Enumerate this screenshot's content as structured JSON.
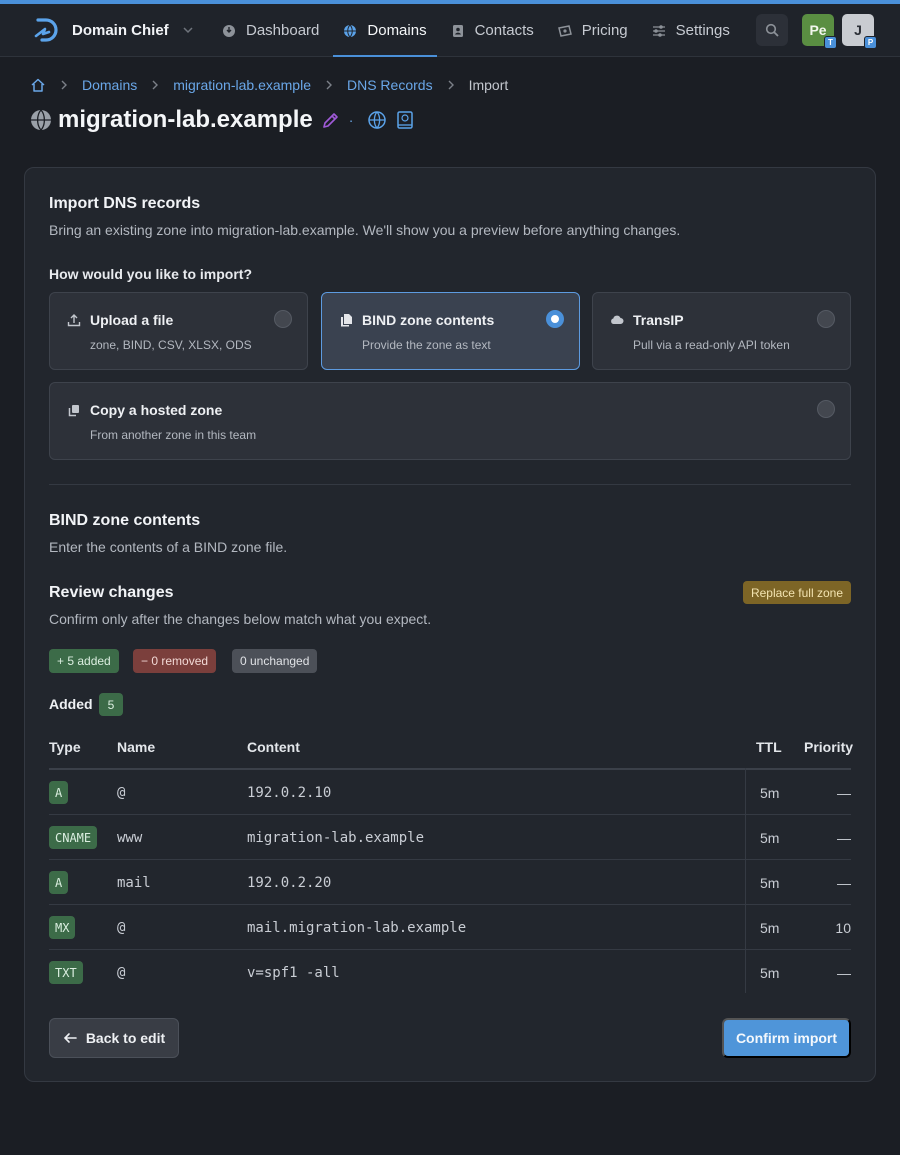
{
  "app": {
    "name": "Domain Chief"
  },
  "nav": {
    "items": [
      {
        "label": "Dashboard",
        "icon": "dashboard-icon",
        "active": false
      },
      {
        "label": "Domains",
        "icon": "globe-icon",
        "active": true
      },
      {
        "label": "Contacts",
        "icon": "contact-card-icon",
        "active": false
      },
      {
        "label": "Pricing",
        "icon": "money-icon",
        "active": false
      },
      {
        "label": "Settings",
        "icon": "sliders-icon",
        "active": false
      }
    ],
    "avatars": [
      {
        "initials": "Pe",
        "badge": "T"
      },
      {
        "initials": "J",
        "badge": "P"
      }
    ]
  },
  "breadcrumb": {
    "items": [
      "Domains",
      "migration-lab.example",
      "DNS Records"
    ],
    "current": "Import"
  },
  "page": {
    "title": "migration-lab.example"
  },
  "import": {
    "heading": "Import DNS records",
    "description": "Bring an existing zone into migration-lab.example. We'll show you a preview before anything changes.",
    "question": "How would you like to import?",
    "options": [
      {
        "title": "Upload a file",
        "desc": "zone, BIND, CSV, XLSX, ODS",
        "icon": "upload-icon",
        "selected": false
      },
      {
        "title": "BIND zone contents",
        "desc": "Provide the zone as text",
        "icon": "documents-icon",
        "selected": true
      },
      {
        "title": "TransIP",
        "desc": "Pull via a read-only API token",
        "icon": "cloud-icon",
        "selected": false
      },
      {
        "title": "Copy a hosted zone",
        "desc": "From another zone in this team",
        "icon": "copy-icon",
        "selected": false
      }
    ]
  },
  "bind": {
    "heading": "BIND zone contents",
    "description": "Enter the contents of a BIND zone file."
  },
  "review": {
    "heading": "Review changes",
    "description": "Confirm only after the changes below match what you expect.",
    "mode_badge": "Replace full zone",
    "pills": {
      "added": "+ 5 added",
      "removed": "− 0 removed",
      "unchanged": "0 unchanged"
    },
    "added_label": "Added",
    "added_count": "5",
    "columns": {
      "type": "Type",
      "name": "Name",
      "content": "Content",
      "ttl": "TTL",
      "priority": "Priority"
    },
    "rows": [
      {
        "type": "A",
        "name": "@",
        "content": "192.0.2.10",
        "ttl": "5m",
        "priority": "—"
      },
      {
        "type": "CNAME",
        "name": "www",
        "content": "migration-lab.example",
        "ttl": "5m",
        "priority": "—"
      },
      {
        "type": "A",
        "name": "mail",
        "content": "192.0.2.20",
        "ttl": "5m",
        "priority": "—"
      },
      {
        "type": "MX",
        "name": "@",
        "content": "mail.migration-lab.example",
        "ttl": "5m",
        "priority": "10"
      },
      {
        "type": "TXT",
        "name": "@",
        "content": "v=spf1 -all",
        "ttl": "5m",
        "priority": "—"
      }
    ]
  },
  "actions": {
    "back": "Back to edit",
    "confirm": "Confirm import"
  },
  "colors": {
    "accent": "#4a90d9",
    "added": "#3c6b48",
    "removed": "#7b3f3c",
    "warning": "#7d6526"
  }
}
